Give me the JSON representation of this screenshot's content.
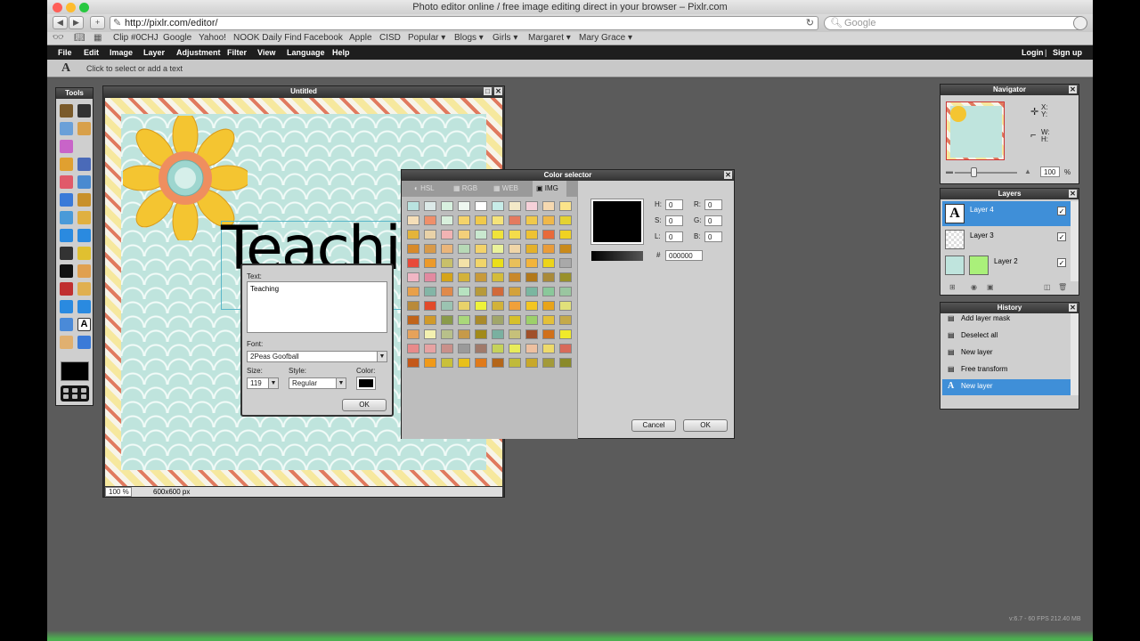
{
  "browser": {
    "title": "Photo editor online / free image editing direct in your browser – Pixlr.com",
    "url": "http://pixlr.com/editor/",
    "search_placeholder": "Google",
    "back": "◀",
    "fwd": "▶",
    "add": "+",
    "reload": "↻",
    "bookmarks": [
      "Clip #0CHJ",
      "Google",
      "Yahoo!",
      "NOOK Daily Find",
      "Facebook",
      "Apple",
      "CISD",
      "Popular ▾",
      "Blogs ▾",
      "Girls ▾",
      "Margaret ▾",
      "Mary Grace ▾"
    ]
  },
  "menu": {
    "items": [
      "File",
      "Edit",
      "Image",
      "Layer",
      "Adjustment",
      "Filter",
      "View",
      "Language",
      "Help"
    ],
    "login": "Login",
    "sep": "|",
    "signup": "Sign up"
  },
  "options": {
    "tool_glyph": "A",
    "hint": "Click to select or add a text"
  },
  "tools": {
    "title": "Tools"
  },
  "document": {
    "title": "Untitled",
    "zoom": "100",
    "zoom_unit": "%",
    "size": "600x600 px",
    "canvas_text": "Teachin"
  },
  "text_dialog": {
    "text_label": "Text:",
    "text_value": "Teaching",
    "font_label": "Font:",
    "font_value": "2Peas Goofball",
    "size_label": "Size:",
    "size_value": "119",
    "style_label": "Style:",
    "style_value": "Regular",
    "color_label": "Color:",
    "ok": "OK"
  },
  "color_selector": {
    "title": "Color selector",
    "tabs": [
      "HSL",
      "RGB",
      "WEB",
      "IMG"
    ],
    "active_tab": "IMG",
    "fields": [
      {
        "label": "H:",
        "value": "0"
      },
      {
        "label": "S:",
        "value": "0"
      },
      {
        "label": "L:",
        "value": "0"
      },
      {
        "label": "R:",
        "value": "0"
      },
      {
        "label": "G:",
        "value": "0"
      },
      {
        "label": "B:",
        "value": "0"
      }
    ],
    "hex_label": "#",
    "hex_value": "000000",
    "cancel": "Cancel",
    "ok": "OK",
    "current_color": "#000000",
    "swatches": [
      [
        "#b9e3e0",
        "#dce9e8",
        "#d8f1df",
        "#eef7f0",
        "#ffffff",
        "#c7ece8",
        "#f3e9c8",
        "#f6d1d9",
        "#f6d9b0",
        "#fbe38a"
      ],
      [
        "#f5deb8",
        "#ef8f6a",
        "#d8efdc",
        "#f5d36a",
        "#f0c94a",
        "#f5e37a",
        "#e47a5f",
        "#f0c94a",
        "#efb84a",
        "#e4d232"
      ],
      [
        "#e4b43a",
        "#e8d2a8",
        "#f1b3b3",
        "#f3cf7a",
        "#c9e8cf",
        "#f0e33a",
        "#f4dc4a",
        "#eec233",
        "#e86a3a",
        "#f0d222"
      ],
      [
        "#d88a2a",
        "#d89a4a",
        "#eab57a",
        "#b7d9b6",
        "#f3d36a",
        "#eaf29a",
        "#f0d6a8",
        "#e4b12a",
        "#e99c3a",
        "#c98a1a"
      ],
      [
        "#e84a3a",
        "#ec9a2a",
        "#c8c06a",
        "#f3e2a8",
        "#f1d56a",
        "#eadf1a",
        "#e9c05a",
        "#f3b43a",
        "#ecd41a",
        "#a9a9a9"
      ],
      [
        "#f0b6c4",
        "#e28aa0",
        "#d5a41a",
        "#d3b23a",
        "#c89a3a",
        "#d4bc3a",
        "#c9882a",
        "#b2781a",
        "#a98a3a",
        "#99902a"
      ],
      [
        "#e8a04a",
        "#83b5a6",
        "#e08a4a",
        "#b7e2c0",
        "#b79a3a",
        "#d16a3a",
        "#d3a23a",
        "#7ab6a0",
        "#8ac89a",
        "#9ac6a0"
      ],
      [
        "#b98a3a",
        "#e14a2a",
        "#9bc3b1",
        "#e8d26a",
        "#eef23a",
        "#d2b23a",
        "#f0a03a",
        "#f3c622",
        "#e8a41a",
        "#e1e07a"
      ],
      [
        "#c0641a",
        "#d09a2a",
        "#8a9a4a",
        "#aad87a",
        "#a98a2a",
        "#a1a66a",
        "#d6c02a",
        "#9dd06a",
        "#e3c03a",
        "#c4a94a"
      ],
      [
        "#e6a25a",
        "#f3f0b0",
        "#b8c08a",
        "#c69a4a",
        "#a18a1a",
        "#7ab0a0",
        "#c6c07a",
        "#a0502a",
        "#d0701a",
        "#f0ea2a"
      ],
      [
        "#e88a8a",
        "#e6a2a2",
        "#c9908a",
        "#9a9a9a",
        "#a07a6a",
        "#c6d25a",
        "#e8ec5a",
        "#eec0a0",
        "#eeda6a",
        "#d86a5a"
      ],
      [
        "#c4581a",
        "#f09a1a",
        "#c9c03a",
        "#e8c01a",
        "#e07a1a",
        "#b4661a",
        "#c0ba3a",
        "#c8a82a",
        "#a39a3a",
        "#8a8a2a"
      ]
    ]
  },
  "navigator": {
    "title": "Navigator",
    "x": "X:",
    "y": "Y:",
    "w": "W:",
    "h": "H:",
    "zoom": "100",
    "zoom_unit": "%"
  },
  "layers": {
    "title": "Layers",
    "items": [
      {
        "name": "Layer 4",
        "selected": true
      },
      {
        "name": "Layer 3",
        "selected": false
      },
      {
        "name": "Layer 2",
        "selected": false
      }
    ]
  },
  "history": {
    "title": "History",
    "items": [
      {
        "name": "Add layer mask",
        "selected": false
      },
      {
        "name": "Deselect all",
        "selected": false
      },
      {
        "name": "New layer",
        "selected": false
      },
      {
        "name": "Free transform",
        "selected": false
      },
      {
        "name": "New layer",
        "selected": true
      }
    ]
  },
  "footer": {
    "version": "v:6.7 - 60 FPS 212.40 MB"
  },
  "colors": {
    "accent": "#3f8fd8",
    "topbar": "#1e1e1e",
    "workspace": "#5b5b5b"
  }
}
